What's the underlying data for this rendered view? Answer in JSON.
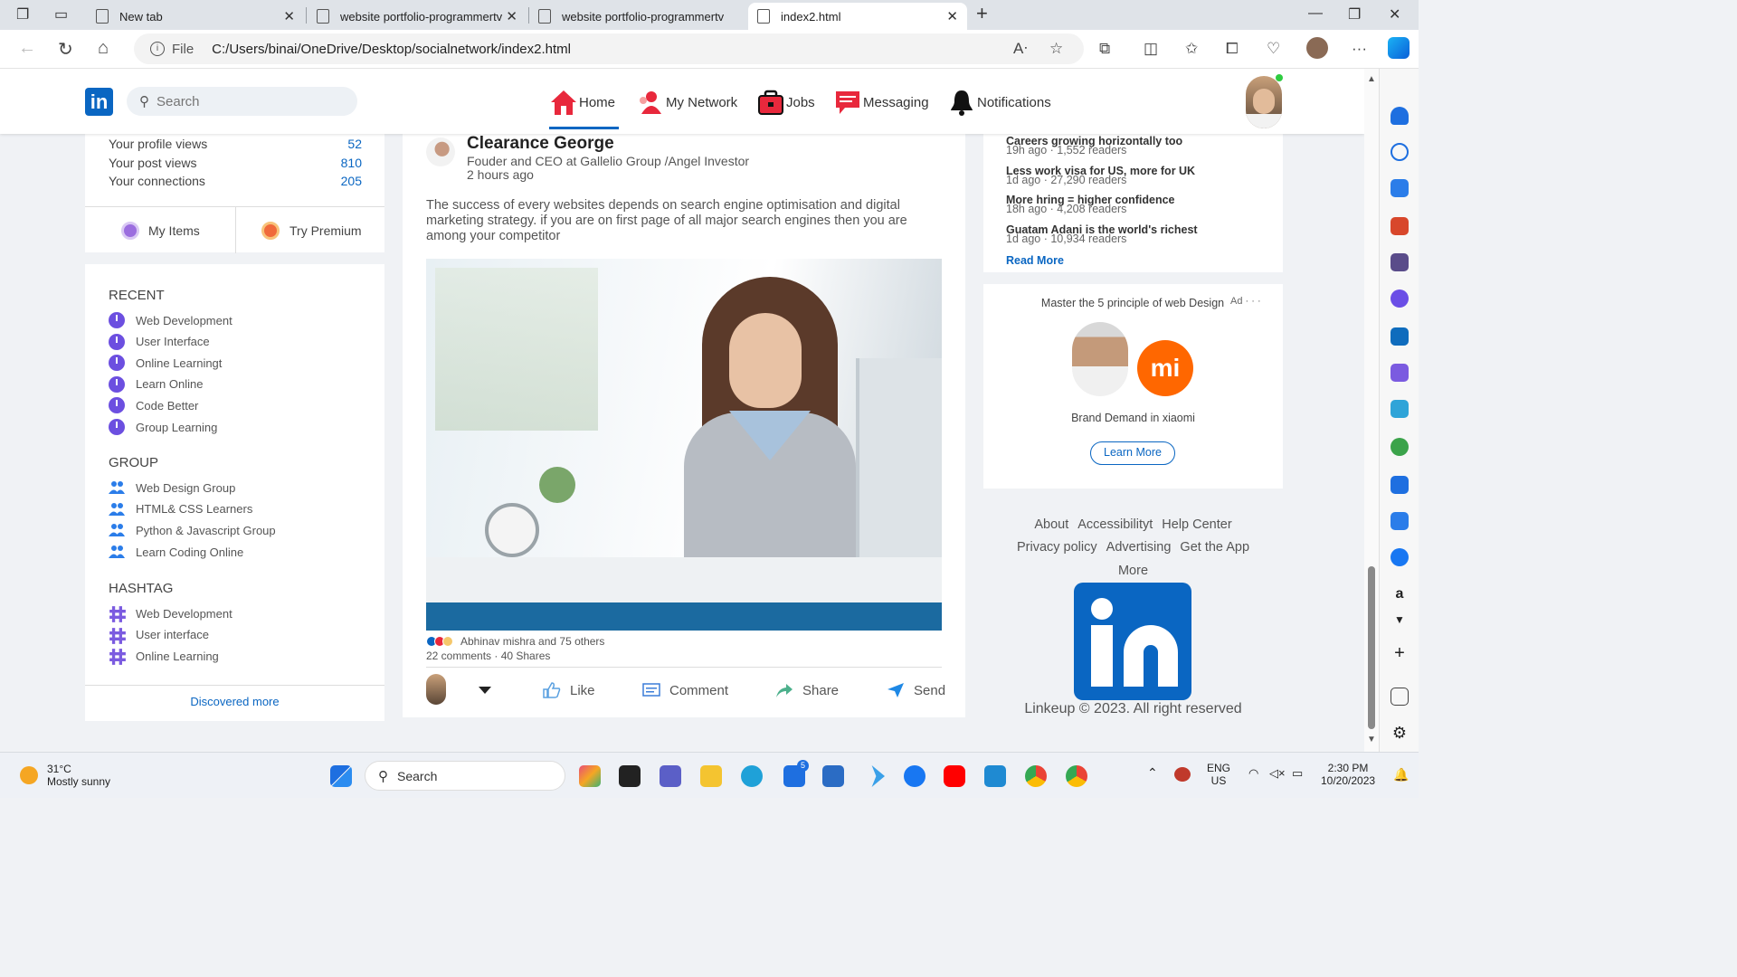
{
  "browser": {
    "tabs": [
      {
        "label": "New tab"
      },
      {
        "label": "website portfolio-programmertv"
      },
      {
        "label": "website portfolio-programmertv"
      },
      {
        "label": "index2.html"
      }
    ],
    "file_label": "File",
    "url": "C:/Users/binai/OneDrive/Desktop/socialnetwork/index2.html"
  },
  "navbar": {
    "logo": "in",
    "search_placeholder": "Search",
    "items": [
      {
        "label": "Home",
        "icon": "home-icon",
        "color": "#e8283c"
      },
      {
        "label": "My Network",
        "icon": "network-icon",
        "color": "#e8283c"
      },
      {
        "label": "Jobs",
        "icon": "briefcase-icon",
        "color": "#e8283c"
      },
      {
        "label": "Messaging",
        "icon": "message-icon",
        "color": "#e8283c"
      },
      {
        "label": "Notifications",
        "icon": "bell-icon",
        "color": "#111111"
      }
    ]
  },
  "profile_stats": [
    {
      "label": "Your profile views",
      "value": "52"
    },
    {
      "label": "Your post views",
      "value": "810"
    },
    {
      "label": "Your connections",
      "value": "205"
    }
  ],
  "left_buttons": {
    "items": "My Items",
    "premium": "Try Premium"
  },
  "recent": {
    "title": "RECENT",
    "items": [
      "Web Development",
      "User Interface",
      "Online Learningt",
      "Learn Online",
      "Code Better",
      "Group Learning"
    ]
  },
  "group": {
    "title": "GROUP",
    "items": [
      "Web Design Group",
      "HTML& CSS Learners",
      "Python & Javascript Group",
      "Learn Coding Online"
    ]
  },
  "hashtag": {
    "title": "HASHTAG",
    "items": [
      "Web Development",
      "User interface",
      "Online Learning"
    ]
  },
  "discover": "Discovered more",
  "post": {
    "author": "Clearance George",
    "subtitle": "Fouder and CEO at Gallelio Group /Angel Investor",
    "time": "2 hours ago",
    "text": "The success of every websites depends on search engine optimisation and digital marketing strategy. if you are on first page of all major search engines then you are among your competitor",
    "reactions": "Abhinav mishra and 75 others",
    "counts": "22 comments · 40 Shares",
    "actions": [
      "Like",
      "Comment",
      "Share",
      "Send"
    ]
  },
  "news": {
    "items": [
      {
        "title": "Careers growing horizontally too",
        "meta": "19h ago · 1,552 readers"
      },
      {
        "title": "Less work visa for US, more for UK",
        "meta": "1d ago · 27,290 readers"
      },
      {
        "title": "More hring = higher confidence",
        "meta": "18h ago · 4,208 readers"
      },
      {
        "title": "Guatam Adani is the world's richest",
        "meta": "1d ago · 10,934 readers"
      }
    ],
    "read_more": "Read More"
  },
  "ad": {
    "title": "Master the 5 principle of web Design",
    "tag": "Ad · · ·",
    "logo_text": "mi",
    "brand": "Brand Demand in xiaomi",
    "button": "Learn More"
  },
  "footer": {
    "row1": [
      "About",
      "Accessibilityt",
      "Help Center"
    ],
    "row2": [
      "Privacy policy",
      "Advertising",
      "Get the App"
    ],
    "row3": "More",
    "copyright": "Linkeup © 2023. All right reserved"
  },
  "taskbar": {
    "temp": "31°C",
    "weather": "Mostly sunny",
    "search": "Search",
    "lang1": "ENG",
    "lang2": "US",
    "time": "2:30 PM",
    "date": "10/20/2023",
    "badge": "5"
  }
}
